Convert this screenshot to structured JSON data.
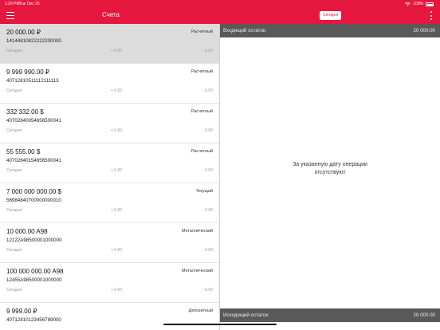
{
  "status": {
    "time": "1:20 PM",
    "date": "Tue Dec 25",
    "battery": "100%"
  },
  "nav": {
    "title": "Счета",
    "today_label": "Сегодня"
  },
  "accounts": [
    {
      "amount": "20 000.00 ₽",
      "number": "14144810822222200000",
      "type": "Расчетный",
      "date": "Сегодня",
      "inc": "+ 0.00",
      "dec": "- 0.00"
    },
    {
      "amount": "9 999 990.00 ₽",
      "number": "40712810511112111113",
      "type": "Расчетный",
      "date": "Сегодня",
      "inc": "+ 0.00",
      "dec": "- 0.00"
    },
    {
      "amount": "332 332.00 $",
      "number": "40702840054656500041",
      "type": "Расчетный",
      "date": "Сегодня",
      "inc": "+ 0.00",
      "dec": "- 0.00"
    },
    {
      "amount": "55 555.00 $",
      "number": "40702840154656500041",
      "type": "Расчетный",
      "date": "Сегодня",
      "inc": "+ 0.00",
      "dec": "- 0.00"
    },
    {
      "amount": "7 000 000 000.00 $",
      "number": "56984840700000000010",
      "type": "Текущий",
      "date": "Сегодня",
      "inc": "+ 0.00",
      "dec": "- 0.00"
    },
    {
      "amount": "10 000.00 A98",
      "number": "12122A98500001000000",
      "type": "Металлический",
      "date": "Сегодня",
      "inc": "+ 0.00",
      "dec": "- 0.00"
    },
    {
      "amount": "100 000 000.00 A98",
      "number": "12455A98500001000000",
      "type": "Металлический",
      "date": "Сегодня",
      "inc": "+ 0.00",
      "dec": "- 0.00"
    },
    {
      "amount": "9 999.00 ₽",
      "number": "40712810123456789000",
      "type": "Депозитный",
      "date": "",
      "inc": "",
      "dec": ""
    }
  ],
  "detail": {
    "opening_label": "Входящий остаток:",
    "opening_value": "20 000.00",
    "empty_message": "За указанную дату операции отсутствуют",
    "closing_label": "Исходящий остаток:",
    "closing_value": "20 000.00"
  }
}
